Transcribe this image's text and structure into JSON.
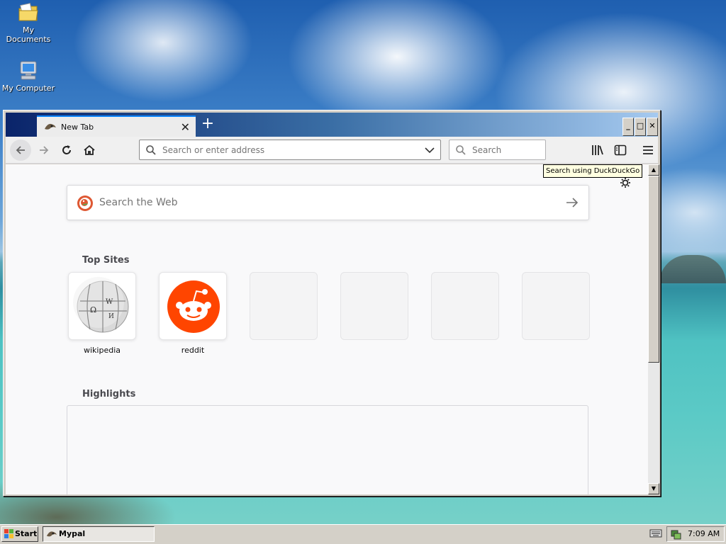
{
  "desktop": {
    "icons": [
      {
        "label": "My Documents",
        "icon": "folder-icon"
      },
      {
        "label": "My Computer",
        "icon": "computer-icon"
      }
    ]
  },
  "browser": {
    "tab": {
      "title": "New Tab"
    },
    "window_controls": {
      "minimize": "_",
      "maximize": "□",
      "close": "✕"
    },
    "urlbar": {
      "placeholder": "Search or enter address",
      "value": ""
    },
    "searchbar": {
      "placeholder": "Search"
    },
    "tooltip": "Search using DuckDuckGo",
    "newtab_page": {
      "web_search_placeholder": "Search the Web",
      "top_sites_title": "Top Sites",
      "top_sites": [
        {
          "label": "wikipedia",
          "icon": "wikipedia-globe-icon"
        },
        {
          "label": "reddit",
          "icon": "reddit-alien-icon"
        },
        {
          "label": ""
        },
        {
          "label": ""
        },
        {
          "label": ""
        },
        {
          "label": ""
        }
      ],
      "highlights_title": "Highlights"
    },
    "colors": {
      "accent": "#0a84ff",
      "reddit": "#ff4500",
      "ddg": "#de5833"
    }
  },
  "taskbar": {
    "start_label": "Start",
    "tasks": [
      {
        "label": "Mypal"
      }
    ],
    "clock": "7:09 AM"
  }
}
